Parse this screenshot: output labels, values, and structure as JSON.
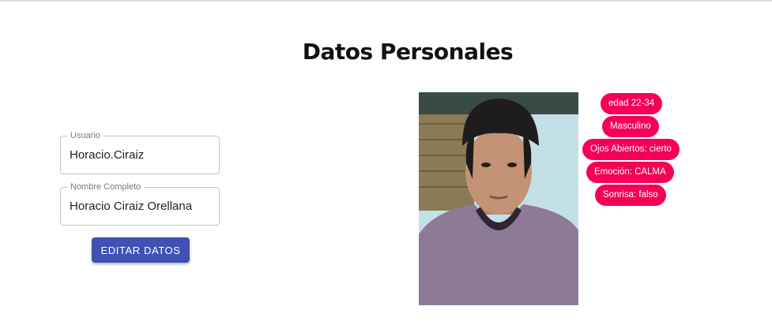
{
  "page": {
    "title": "Datos Personales"
  },
  "form": {
    "user": {
      "label": "Usuario",
      "value": "Horacio.Ciraiz"
    },
    "fullname": {
      "label": "Nombre Completo",
      "value": "Horacio Ciraiz Orellana"
    },
    "edit_button_label": "EDITAR DATOS"
  },
  "analysis": {
    "chips": [
      "edad 22-34",
      "Masculino",
      "Ojos Abiertos: cierto",
      "Emoción: CALMA",
      "Sonrisa: falso"
    ]
  },
  "colors": {
    "primary": "#3f51b5",
    "chip": "#f50057"
  }
}
